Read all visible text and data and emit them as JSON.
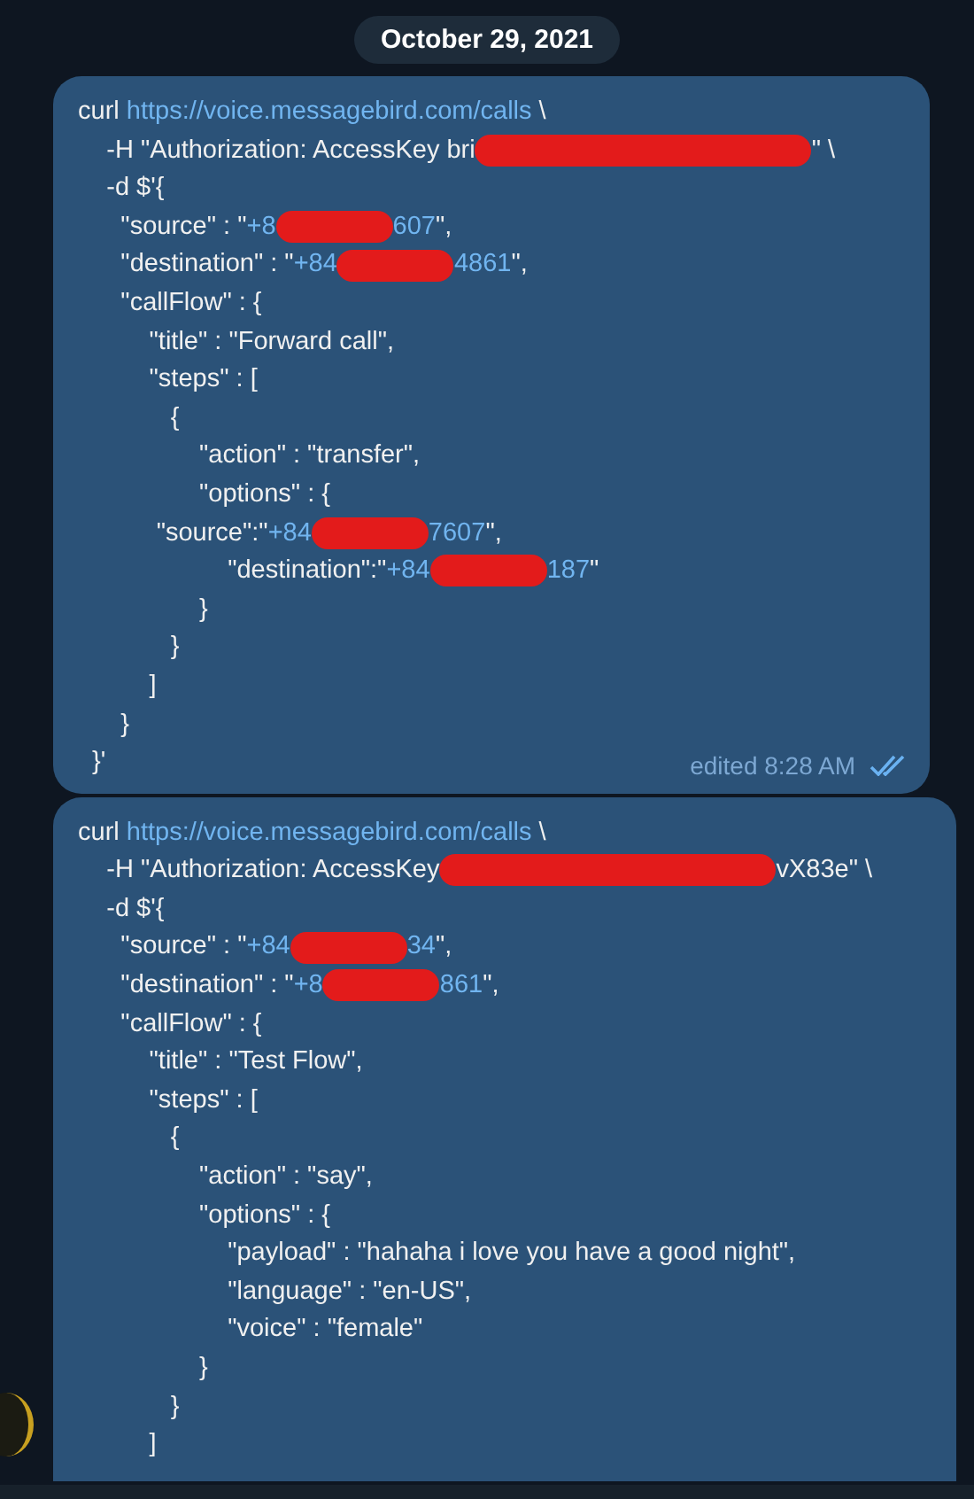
{
  "date_badge": "October 29, 2021",
  "messages": [
    {
      "lines": [
        [
          {
            "kind": "text",
            "text": "curl "
          },
          {
            "kind": "link",
            "text": "https://voice.messagebird.com/calls"
          },
          {
            "kind": "text",
            "text": " \\"
          }
        ],
        [
          {
            "kind": "text",
            "text": "    -H \"Authorization: AccessKey bri"
          },
          {
            "kind": "redacted-long"
          },
          {
            "kind": "text",
            "text": "\" \\"
          }
        ],
        [
          {
            "kind": "text",
            "text": "    -d $'{"
          }
        ],
        [
          {
            "kind": "text",
            "text": "      \"source\" : \""
          },
          {
            "kind": "link",
            "text": "+8"
          },
          {
            "kind": "redacted-short"
          },
          {
            "kind": "link",
            "text": "607"
          },
          {
            "kind": "text",
            "text": "\","
          }
        ],
        [
          {
            "kind": "text",
            "text": "      \"destination\" : \""
          },
          {
            "kind": "link",
            "text": "+84"
          },
          {
            "kind": "redacted-short"
          },
          {
            "kind": "link",
            "text": "4861"
          },
          {
            "kind": "text",
            "text": "\","
          }
        ],
        [
          {
            "kind": "text",
            "text": "      \"callFlow\" : {"
          }
        ],
        [
          {
            "kind": "text",
            "text": "          \"title\" : \"Forward call\","
          }
        ],
        [
          {
            "kind": "text",
            "text": "          \"steps\" : ["
          }
        ],
        [
          {
            "kind": "text",
            "text": "             {"
          }
        ],
        [
          {
            "kind": "text",
            "text": "                 \"action\" : \"transfer\","
          }
        ],
        [
          {
            "kind": "text",
            "text": "                 \"options\" : {"
          }
        ],
        [
          {
            "kind": "text",
            "text": "           \"source\":\""
          },
          {
            "kind": "link",
            "text": "+84"
          },
          {
            "kind": "redacted-short"
          },
          {
            "kind": "link",
            "text": "7607"
          },
          {
            "kind": "text",
            "text": "\","
          }
        ],
        [
          {
            "kind": "text",
            "text": "                     \"destination\":\""
          },
          {
            "kind": "link",
            "text": "+84"
          },
          {
            "kind": "redacted-short"
          },
          {
            "kind": "link",
            "text": "187"
          },
          {
            "kind": "text",
            "text": "\""
          }
        ],
        [
          {
            "kind": "text",
            "text": "                 }"
          }
        ],
        [
          {
            "kind": "text",
            "text": "             }"
          }
        ],
        [
          {
            "kind": "text",
            "text": "          ]"
          }
        ],
        [
          {
            "kind": "text",
            "text": "      }"
          }
        ],
        [
          {
            "kind": "text",
            "text": "  }'"
          }
        ]
      ],
      "footer": {
        "status": "edited 8:28 AM",
        "read": true
      }
    },
    {
      "lines": [
        [
          {
            "kind": "text",
            "text": "curl "
          },
          {
            "kind": "link",
            "text": "https://voice.messagebird.com/calls"
          },
          {
            "kind": "text",
            "text": " \\"
          }
        ],
        [
          {
            "kind": "text",
            "text": "    -H \"Authorization: AccessKey"
          },
          {
            "kind": "redacted-long"
          },
          {
            "kind": "text",
            "text": "vX83e\" \\"
          }
        ],
        [
          {
            "kind": "text",
            "text": "    -d $'{"
          }
        ],
        [
          {
            "kind": "text",
            "text": "      \"source\" : \""
          },
          {
            "kind": "link",
            "text": "+84"
          },
          {
            "kind": "redacted-short"
          },
          {
            "kind": "link",
            "text": "34"
          },
          {
            "kind": "text",
            "text": "\","
          }
        ],
        [
          {
            "kind": "text",
            "text": "      \"destination\" : \""
          },
          {
            "kind": "link",
            "text": "+8"
          },
          {
            "kind": "redacted-short"
          },
          {
            "kind": "link",
            "text": "861"
          },
          {
            "kind": "text",
            "text": "\","
          }
        ],
        [
          {
            "kind": "text",
            "text": "      \"callFlow\" : {"
          }
        ],
        [
          {
            "kind": "text",
            "text": "          \"title\" : \"Test Flow\","
          }
        ],
        [
          {
            "kind": "text",
            "text": "          \"steps\" : ["
          }
        ],
        [
          {
            "kind": "text",
            "text": "             {"
          }
        ],
        [
          {
            "kind": "text",
            "text": "                 \"action\" : \"say\","
          }
        ],
        [
          {
            "kind": "text",
            "text": "                 \"options\" : {"
          }
        ],
        [
          {
            "kind": "text",
            "text": "                     \"payload\" : \"hahaha i love you have a good night\","
          }
        ],
        [
          {
            "kind": "text",
            "text": "                     \"language\" : \"en-US\","
          }
        ],
        [
          {
            "kind": "text",
            "text": "                     \"voice\" : \"female\""
          }
        ],
        [
          {
            "kind": "text",
            "text": "                 }"
          }
        ],
        [
          {
            "kind": "text",
            "text": "             }"
          }
        ],
        [
          {
            "kind": "text",
            "text": "          ]"
          }
        ]
      ]
    }
  ]
}
